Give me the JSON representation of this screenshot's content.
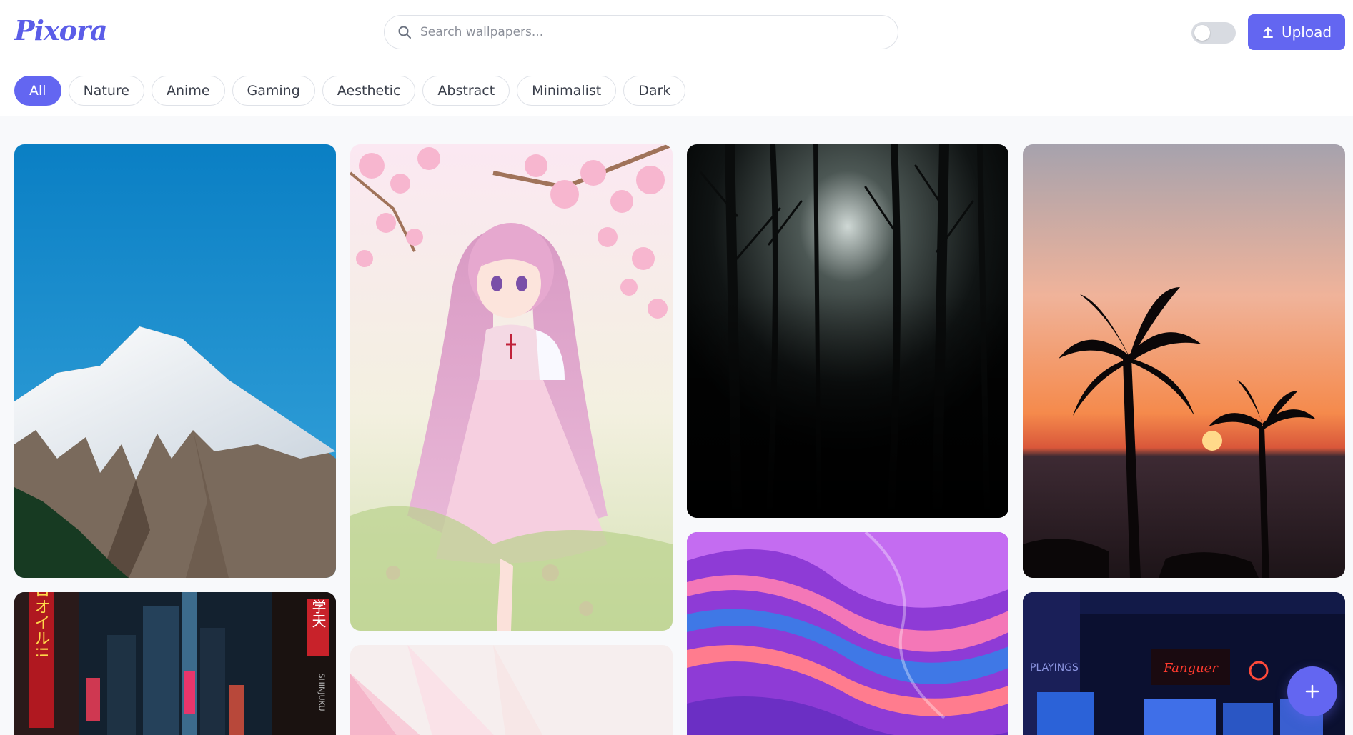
{
  "app": {
    "logo_text": "Pixora",
    "accent_color": "#6366f1"
  },
  "header": {
    "search_placeholder": "Search wallpapers...",
    "theme_toggle_on": false,
    "upload_label": "Upload",
    "upload_icon": "upload-icon"
  },
  "categories": [
    {
      "label": "All",
      "active": true
    },
    {
      "label": "Nature",
      "active": false
    },
    {
      "label": "Anime",
      "active": false
    },
    {
      "label": "Gaming",
      "active": false
    },
    {
      "label": "Aesthetic",
      "active": false
    },
    {
      "label": "Abstract",
      "active": false
    },
    {
      "label": "Minimalist",
      "active": false
    },
    {
      "label": "Dark",
      "active": false
    }
  ],
  "gallery": {
    "items": [
      {
        "name": "mountain-wallpaper",
        "scene": "snowy mountain under blue sky"
      },
      {
        "name": "anime-girl-wallpaper",
        "scene": "anime girl under cherry blossoms"
      },
      {
        "name": "dark-forest-wallpaper",
        "scene": "dark misty forest"
      },
      {
        "name": "palm-sunset-wallpaper",
        "scene": "palm trees at sunset"
      },
      {
        "name": "neon-city-wallpaper",
        "scene": "neon city street at night",
        "signs": [
          "ロオイル!!",
          "学天",
          "SHINJUKU"
        ]
      },
      {
        "name": "pink-geometric-wallpaper",
        "scene": "soft pink geometric"
      },
      {
        "name": "fluid-abstract-wallpaper",
        "scene": "colorful fluid waves"
      },
      {
        "name": "gaming-room-wallpaper",
        "scene": "neon gaming room",
        "signs": [
          "Fanguer",
          "PLAYINGS"
        ]
      }
    ]
  },
  "fab": {
    "icon": "plus-icon"
  }
}
